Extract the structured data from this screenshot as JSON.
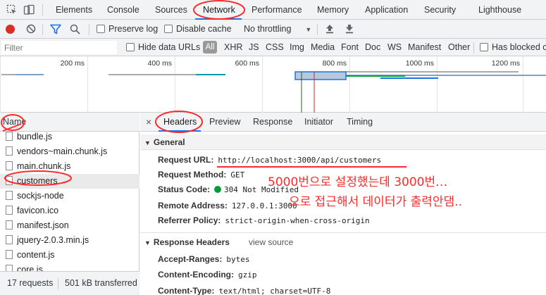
{
  "devtools": {
    "tabs": [
      "Elements",
      "Console",
      "Sources",
      "Network",
      "Performance",
      "Memory",
      "Application",
      "Security",
      "Lighthouse"
    ],
    "active_tab": "Network"
  },
  "toolbar": {
    "preserve_log": "Preserve log",
    "disable_cache": "Disable cache",
    "throttling": "No throttling"
  },
  "filterbar": {
    "placeholder": "Filter",
    "hide_data_urls": "Hide data URLs",
    "types": [
      "All",
      "XHR",
      "JS",
      "CSS",
      "Img",
      "Media",
      "Font",
      "Doc",
      "WS",
      "Manifest",
      "Other"
    ],
    "has_blocked": "Has blocked c"
  },
  "overview": {
    "ticks": [
      "200 ms",
      "400 ms",
      "600 ms",
      "800 ms",
      "1000 ms",
      "1200 ms"
    ]
  },
  "requests": {
    "header": "Name",
    "items": [
      "bundle.js",
      "vendors~main.chunk.js",
      "main.chunk.js",
      "customers",
      "sockjs-node",
      "favicon.ico",
      "manifest.json",
      "jquery-2.0.3.min.js",
      "content.js",
      "core.js"
    ],
    "summary_requests": "17 requests",
    "summary_transferred": "501 kB transferred"
  },
  "details": {
    "tabs": [
      "Headers",
      "Preview",
      "Response",
      "Initiator",
      "Timing"
    ],
    "active_tab": "Headers",
    "general_title": "General",
    "general": [
      {
        "key": "Request URL:",
        "value": "http://localhost:3000/api/customers"
      },
      {
        "key": "Request Method:",
        "value": "GET"
      },
      {
        "key": "Status Code:",
        "value": "304 Not Modified"
      },
      {
        "key": "Remote Address:",
        "value": "127.0.0.1:3000"
      },
      {
        "key": "Referrer Policy:",
        "value": "strict-origin-when-cross-origin"
      }
    ],
    "response_title": "Response Headers",
    "view_source": "view source",
    "response": [
      {
        "key": "Accept-Ranges:",
        "value": "bytes"
      },
      {
        "key": "Content-Encoding:",
        "value": "gzip"
      },
      {
        "key": "Content-Type:",
        "value": "text/html; charset=UTF-8"
      }
    ]
  },
  "annotation": {
    "line1": "5000번으로 설정했는데 3000번…",
    "line2": "으로 접근해서 데이터가 출력안댐.."
  },
  "colors": {
    "accent": "#1a73e8",
    "annotation": "#ff2a2a",
    "status_ok": "#0a9a3a"
  }
}
